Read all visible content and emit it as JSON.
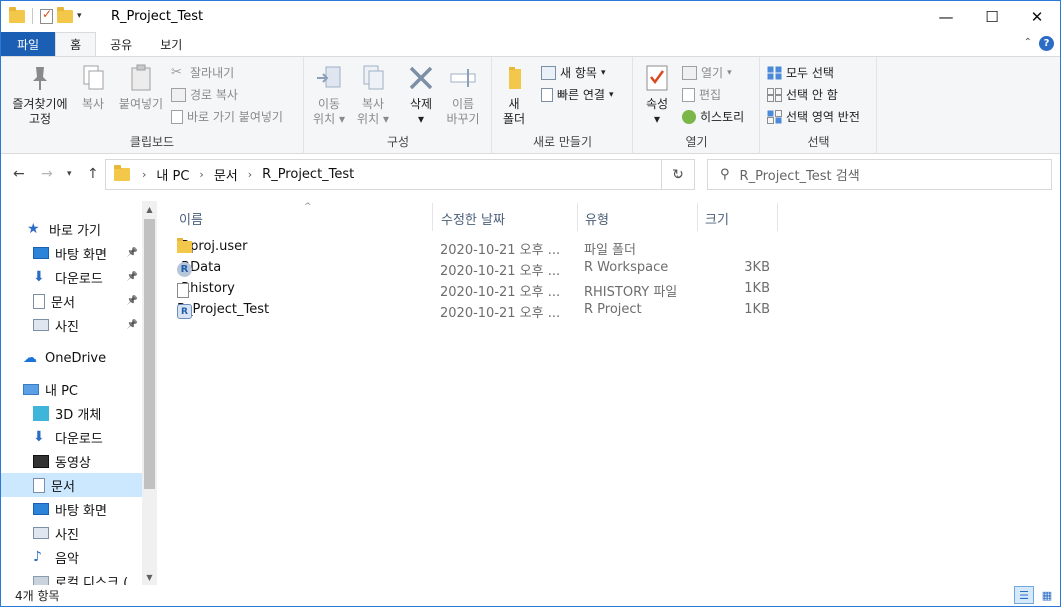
{
  "window": {
    "title": "R_Project_Test",
    "min_label": "—",
    "max_label": "☐",
    "close_label": "✕"
  },
  "tabs": [
    {
      "label": "파일"
    },
    {
      "label": "홈"
    },
    {
      "label": "공유"
    },
    {
      "label": "보기"
    }
  ],
  "ribbon": {
    "clipboard": {
      "pin_line1": "즐겨찾기에",
      "pin_line2": "고정",
      "copy": "복사",
      "paste": "붙여넣기",
      "cut": "잘라내기",
      "copy_path": "경로 복사",
      "paste_shortcut": "바로 가기 붙여넣기",
      "label": "클립보드"
    },
    "organize": {
      "move_line1": "이동",
      "move_line2": "위치",
      "copyto_line1": "복사",
      "copyto_line2": "위치",
      "delete": "삭제",
      "rename_line1": "이름",
      "rename_line2": "바꾸기",
      "label": "구성"
    },
    "new": {
      "folder_line1": "새",
      "folder_line2": "폴더",
      "new_item": "새 항목",
      "easy_access": "빠른 연결",
      "label": "새로 만들기"
    },
    "open": {
      "properties": "속성",
      "open": "열기",
      "edit": "편집",
      "history": "히스토리",
      "label": "열기"
    },
    "select": {
      "select_all": "모두 선택",
      "select_none": "선택 안 함",
      "invert": "선택 영역 반전",
      "label": "선택"
    }
  },
  "address": {
    "crumbs": [
      "내 PC",
      "문서",
      "R_Project_Test"
    ],
    "search_placeholder": "R_Project_Test 검색"
  },
  "sidebar": {
    "items": [
      {
        "label": "바로 가기",
        "icon": "star-icon",
        "pinned": false
      },
      {
        "label": "바탕 화면",
        "icon": "desktop-icon",
        "pinned": true
      },
      {
        "label": "다운로드",
        "icon": "download-icon",
        "pinned": true
      },
      {
        "label": "문서",
        "icon": "document-icon",
        "pinned": true
      },
      {
        "label": "사진",
        "icon": "picture-icon",
        "pinned": true
      },
      {
        "label": "OneDrive",
        "icon": "cloud-icon",
        "pinned": false
      },
      {
        "label": "내 PC",
        "icon": "computer-icon",
        "pinned": false
      },
      {
        "label": "3D 개체",
        "icon": "cube-icon",
        "pinned": false
      },
      {
        "label": "다운로드",
        "icon": "download-icon",
        "pinned": false
      },
      {
        "label": "동영상",
        "icon": "video-icon",
        "pinned": false
      },
      {
        "label": "문서",
        "icon": "document-icon",
        "pinned": false,
        "selected": true
      },
      {
        "label": "바탕 화면",
        "icon": "desktop-icon",
        "pinned": false
      },
      {
        "label": "사진",
        "icon": "picture-icon",
        "pinned": false
      },
      {
        "label": "음악",
        "icon": "music-icon",
        "pinned": false
      },
      {
        "label": "로컬 디스크 (",
        "icon": "disk-icon",
        "pinned": false
      }
    ]
  },
  "columns": {
    "name": "이름",
    "date": "수정한 날짜",
    "type": "유형",
    "size": "크기"
  },
  "files": [
    {
      "name": ".Rproj.user",
      "date": "2020-10-21 오후 ...",
      "type": "파일 폴더",
      "size": "",
      "icon": "folder-icon"
    },
    {
      "name": ".RData",
      "date": "2020-10-21 오후 ...",
      "type": "R Workspace",
      "size": "3KB",
      "icon": "r-data-icon"
    },
    {
      "name": ".Rhistory",
      "date": "2020-10-21 오후 ...",
      "type": "RHISTORY 파일",
      "size": "1KB",
      "icon": "file-icon"
    },
    {
      "name": "R_Project_Test",
      "date": "2020-10-21 오후 ...",
      "type": "R Project",
      "size": "1KB",
      "icon": "r-project-icon"
    }
  ],
  "status": {
    "count": "4개 항목"
  }
}
